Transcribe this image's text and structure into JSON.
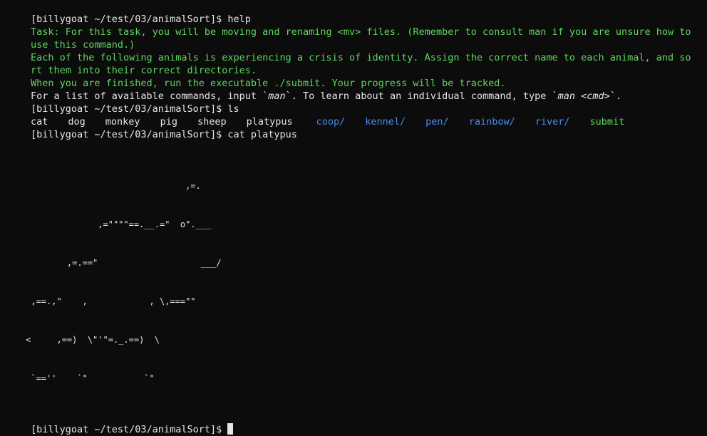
{
  "prompt": "[billygoat ~/test/03/animalSort]$",
  "commands": {
    "help": "help",
    "ls": "ls",
    "cat": "cat platypus"
  },
  "help_text": {
    "task_line": "Task: For this task, you will be moving and renaming <mv> files. (Remember to consult man if you are unsure how to use this command.)",
    "identity_line": "Each of the following animals is experiencing a crisis of identity. Assign the correct name to each animal, and sort them into their correct directories.",
    "submit_line": "When you are finished, run the executable ./submit. Your progress will be tracked.",
    "commands_line_a": "For a list of available commands, input `",
    "commands_man": "man",
    "commands_line_b": "`. To learn about an individual command, type `",
    "commands_man_cmd": "man <cmd>",
    "commands_line_c": "`."
  },
  "ls_output": {
    "files": [
      "cat",
      "dog",
      "monkey",
      "pig",
      "sheep",
      "platypus"
    ],
    "dirs": [
      "coop/",
      "kennel/",
      "pen/",
      "rainbow/",
      "river/"
    ],
    "executables": [
      "submit"
    ]
  },
  "platypus_art": [
    "                                    ,=.",
    "                   ,=\"\"\"\"==.__.=\"  o\".___",
    "             ,=.==\"                    ___/",
    "      ,==.,\"    ,            , \\,===\"\"",
    "     <     ,==)  \\\"'\"=._.==)  \\",
    "      `==''    `\"           `\""
  ],
  "colors": {
    "background": "#0c0c0c",
    "text": "#e6e6e6",
    "green": "#5fd75f",
    "directory": "#4a8cf0"
  }
}
